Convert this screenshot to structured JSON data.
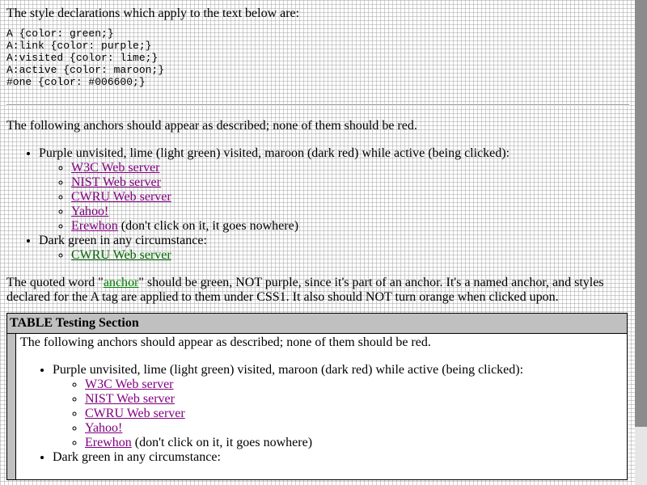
{
  "intro": "The style declarations which apply to the text below are:",
  "css_code": "A {color: green;}\nA:link {color: purple;}\nA:visited {color: lime;}\nA:active {color: maroon;}\n#one {color: #006600;}",
  "section1": {
    "anchors_desc": "The following anchors should appear as described; none of them should be red.",
    "purple_desc": "Purple unvisited, lime (light green) visited, maroon (dark red) while active (being clicked):",
    "links": {
      "w3c": "W3C Web server",
      "nist": "NIST Web server",
      "cwru": "CWRU Web server",
      "yahoo": "Yahoo!",
      "erewhon": "Erewhon"
    },
    "erewhon_note": " (don't click on it, it goes nowhere)",
    "green_desc": "Dark green in any circumstance:",
    "green_link": "CWRU Web server"
  },
  "quoted": {
    "before": "The quoted word \"",
    "word": "anchor",
    "after": "\" should be green, NOT purple, since it's part of an anchor. It's a named anchor, and styles declared for the A tag are applied to them under CSS1. It also should NOT turn orange when clicked upon."
  },
  "table": {
    "header": "TABLE Testing Section",
    "anchors_desc": "The following anchors should appear as described; none of them should be red.",
    "purple_desc": "Purple unvisited, lime (light green) visited, maroon (dark red) while active (being clicked):",
    "links": {
      "w3c": "W3C Web server",
      "nist": "NIST Web server",
      "cwru": "CWRU Web server",
      "yahoo": "Yahoo!",
      "erewhon": "Erewhon"
    },
    "erewhon_note": " (don't click on it, it goes nowhere)",
    "green_desc": "Dark green in any circumstance:"
  },
  "colors": {
    "link_unvisited": "#800080",
    "link_dark_green": "#006600",
    "anchor_green": "#008000",
    "table_header_bg": "#c0c0c0"
  }
}
